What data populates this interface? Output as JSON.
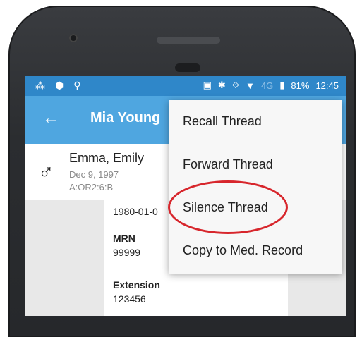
{
  "status_bar": {
    "left_icons": [
      "ts-icon",
      "android-icon",
      "person-icon"
    ],
    "left_glyphs": [
      "⁂",
      "⬢",
      "⚲"
    ],
    "right_glyphs": [
      "▣",
      "✱",
      "⟐",
      "▼"
    ],
    "network": "4G",
    "battery": "81%",
    "time": "12:45"
  },
  "app_bar": {
    "back_glyph": "←",
    "title": "Mia Young"
  },
  "patient": {
    "gender_glyph": "♂",
    "name": "Emma, Emily",
    "dob": "Dec 9, 1997",
    "location": "A:OR2:6:B"
  },
  "details": {
    "date_value": "1980-01-0",
    "mrn_label": "MRN",
    "mrn_value": "99999",
    "extension_label": "Extension",
    "extension_value": "123456"
  },
  "menu": {
    "items": [
      {
        "label": "Recall Thread"
      },
      {
        "label": "Forward Thread"
      },
      {
        "label": "Silence Thread"
      },
      {
        "label": "Copy to Med. Record"
      }
    ]
  },
  "colors": {
    "status_bar": "#2f87c9",
    "app_bar": "#4fa6e0",
    "highlight": "#d7262c"
  }
}
